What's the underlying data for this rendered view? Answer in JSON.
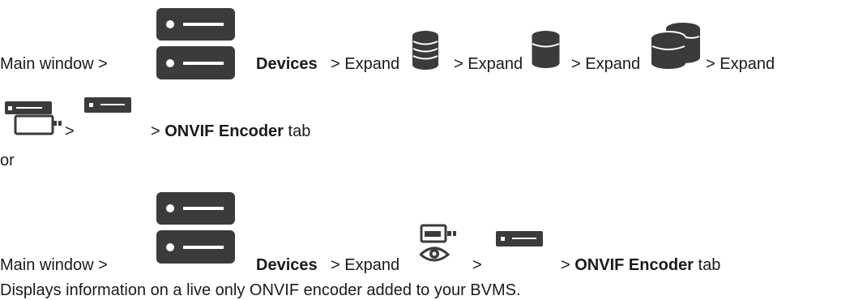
{
  "path1": {
    "main_window": "Main window >",
    "devices": "Devices",
    "seg1": "> Expand",
    "seg2": "> Expand",
    "seg3": "> Expand",
    "seg4": "> Expand"
  },
  "path1b": {
    "sep1": ">",
    "sep2": ">",
    "tab": "ONVIF Encoder",
    "tab_suffix": "tab"
  },
  "or": "or",
  "path2": {
    "main_window": "Main window >",
    "devices": "Devices",
    "expand": "> Expand",
    "sep": ">",
    "sep2": ">",
    "tab": "ONVIF Encoder",
    "tab_suffix": "tab"
  },
  "description": "Displays information on a live only ONVIF encoder added to your BVMS.",
  "icons": {
    "devices": "devices-server-icon",
    "db_stack": "database-stack-icon",
    "db_single": "database-icon",
    "db_double": "database-pair-icon",
    "encoder_group": "encoder-group-icon",
    "encoder": "encoder-icon",
    "live_only": "live-only-encoder-icon"
  }
}
